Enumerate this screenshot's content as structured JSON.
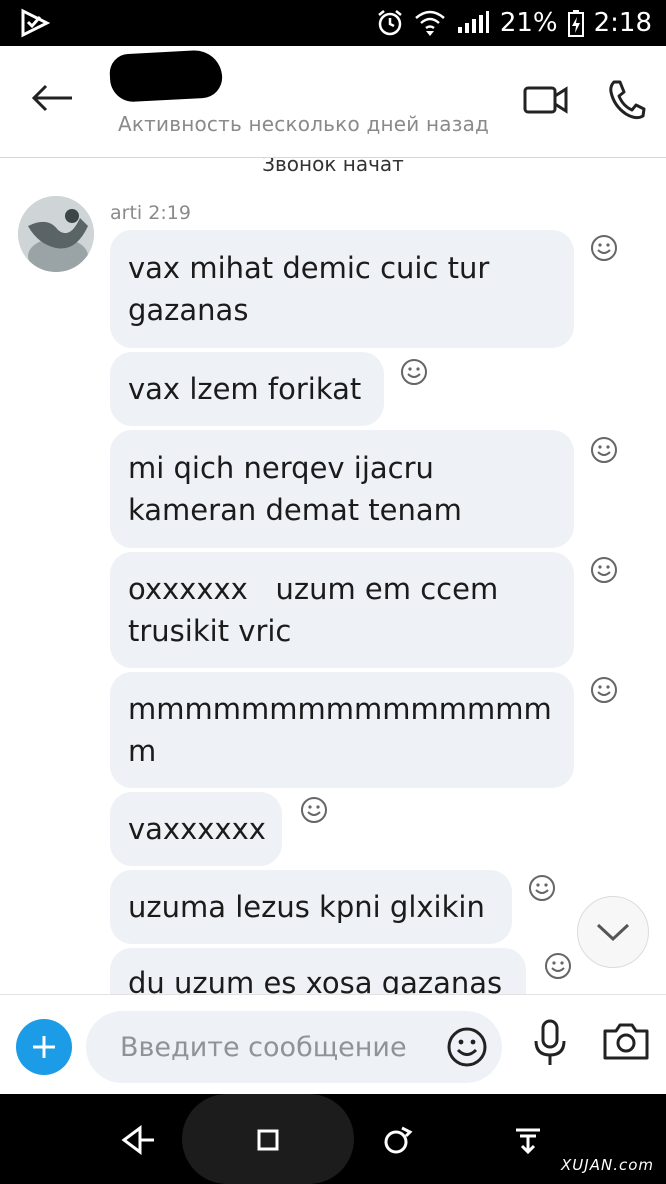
{
  "status_bar": {
    "battery": "21%",
    "time": "2:18"
  },
  "header": {
    "activity": "Активность несколько дней назад"
  },
  "chat": {
    "system_message": "Звонок начат",
    "sender": "arti",
    "sent_time": "2:19",
    "messages": [
      {
        "line1": "vax mihat demic cuic tur",
        "line2": "gazanas"
      },
      {
        "line1": "vax lzem forikat",
        "line2": ""
      },
      {
        "line1": "mi qich nerqev ijacru",
        "line2": "kameran demat tenam"
      },
      {
        "line1": "oxxxxxx   uzum em ccem",
        "line2": "trusikit vric"
      },
      {
        "line1": "mmmmmmmmmmmmmmm",
        "line2": "m"
      },
      {
        "line1": "vaxxxxxx",
        "line2": ""
      },
      {
        "line1": "uzuma lezus kpni glxikin",
        "line2": ""
      },
      {
        "line1": "du uzum es xosa gazanas",
        "line2": ""
      }
    ]
  },
  "composer": {
    "placeholder": "Введите сообщение"
  },
  "watermark": "XUJAN.com",
  "colors": {
    "accent": "#1c9be6",
    "bubble": "#eef1f6",
    "status_bar": "#000000"
  }
}
